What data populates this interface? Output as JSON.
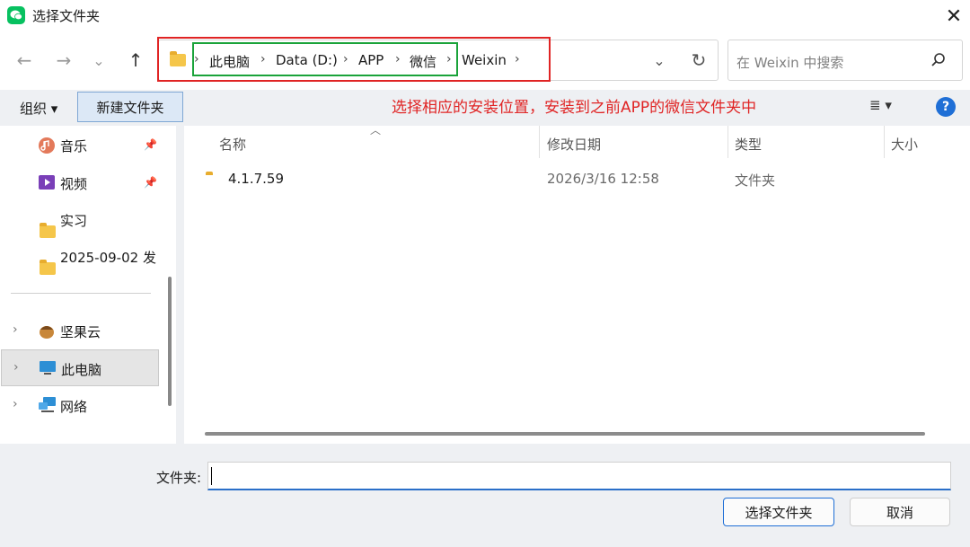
{
  "window": {
    "title": "选择文件夹",
    "close_glyph": "✕",
    "app_icon": "wechat-icon",
    "brand_color": "#07c160"
  },
  "nav": {
    "back_glyph": "←",
    "forward_glyph": "→",
    "recent_glyph": "⌄",
    "up_glyph": "↑",
    "refresh_glyph": "↻",
    "dropdown_glyph": "⌄"
  },
  "breadcrumb": {
    "items": [
      "此电脑",
      "Data (D:)",
      "APP",
      "微信",
      "Weixin"
    ],
    "separator": "›"
  },
  "search": {
    "placeholder": "在 Weixin 中搜索",
    "icon": "search-icon"
  },
  "toolbar": {
    "organize_label": "组织 ▾",
    "new_folder_label": "新建文件夹",
    "view_glyph": "≣ ▾",
    "help_glyph": "?"
  },
  "annotation": {
    "text": "选择相应的安装位置，安装到之前APP的微信文件夹中",
    "color": "#e02424",
    "box_colors": [
      "#e02424",
      "#1aa33a"
    ]
  },
  "sidebar": {
    "items": [
      {
        "label": "音乐",
        "icon": "music-icon",
        "pinned": true
      },
      {
        "label": "视频",
        "icon": "video-icon",
        "pinned": true
      },
      {
        "label": "实习",
        "icon": "folder-icon",
        "pinned": false
      },
      {
        "label": "2025-09-02 发",
        "icon": "folder-icon",
        "pinned": false
      }
    ],
    "roots": [
      {
        "label": "坚果云",
        "icon": "nutstore-icon"
      },
      {
        "label": "此电脑",
        "icon": "computer-icon",
        "selected": true
      },
      {
        "label": "网络",
        "icon": "network-icon"
      }
    ]
  },
  "columns": [
    "名称",
    "修改日期",
    "类型",
    "大小"
  ],
  "files": [
    {
      "name": "4.1.7.59",
      "modified": "2026/3/16 12:58",
      "type": "文件夹",
      "size": ""
    }
  ],
  "footer": {
    "folder_label": "文件夹:",
    "folder_value": "",
    "select_button": "选择文件夹",
    "cancel_button": "取消"
  }
}
